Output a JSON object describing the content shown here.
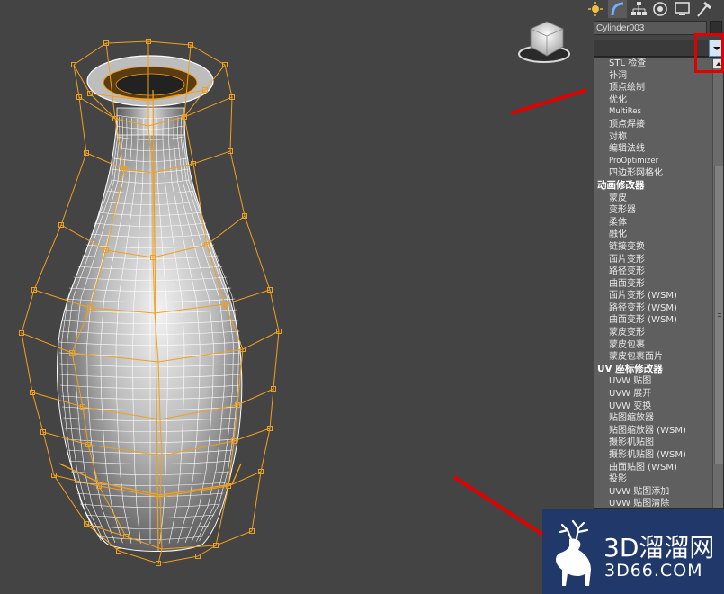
{
  "command_panel": {
    "tabs": [
      "create-tab",
      "modify-tab",
      "hierarchy-tab",
      "motion-tab",
      "display-tab",
      "utilities-tab"
    ],
    "object_name": "Cylinder003",
    "modifier_list_value": ""
  },
  "modifier_list": {
    "items": [
      {
        "type": "item",
        "label": "STL 检查",
        "small": false
      },
      {
        "type": "item",
        "label": "补洞",
        "small": false
      },
      {
        "type": "item",
        "label": "顶点绘制",
        "small": false
      },
      {
        "type": "item",
        "label": "优化",
        "small": false
      },
      {
        "type": "item",
        "label": "MultiRes",
        "small": true
      },
      {
        "type": "item",
        "label": "顶点焊接",
        "small": false
      },
      {
        "type": "item",
        "label": "对称",
        "small": false
      },
      {
        "type": "item",
        "label": "编辑法线",
        "small": false
      },
      {
        "type": "item",
        "label": "ProOptimizer",
        "small": true
      },
      {
        "type": "item",
        "label": "四边形网格化",
        "small": false
      },
      {
        "type": "cat",
        "label": "动画修改器"
      },
      {
        "type": "item",
        "label": "蒙皮",
        "small": false
      },
      {
        "type": "item",
        "label": "变形器",
        "small": false
      },
      {
        "type": "item",
        "label": "柔体",
        "small": false
      },
      {
        "type": "item",
        "label": "融化",
        "small": false
      },
      {
        "type": "item",
        "label": "链接变换",
        "small": false
      },
      {
        "type": "item",
        "label": "面片变形",
        "small": false
      },
      {
        "type": "item",
        "label": "路径变形",
        "small": false
      },
      {
        "type": "item",
        "label": "曲面变形",
        "small": false
      },
      {
        "type": "item",
        "label": "面片变形 (WSM)",
        "small": false
      },
      {
        "type": "item",
        "label": "路径变形 (WSM)",
        "small": false
      },
      {
        "type": "item",
        "label": "曲面变形 (WSM)",
        "small": false
      },
      {
        "type": "item",
        "label": "蒙皮变形",
        "small": false
      },
      {
        "type": "item",
        "label": "蒙皮包裹",
        "small": false
      },
      {
        "type": "item",
        "label": "蒙皮包裹面片",
        "small": false
      },
      {
        "type": "cat",
        "label": "UV 座标修改器"
      },
      {
        "type": "item",
        "label": "UVW 贴图",
        "small": false
      },
      {
        "type": "item",
        "label": "UVW 展开",
        "small": false
      },
      {
        "type": "item",
        "label": "UVW 变换",
        "small": false
      },
      {
        "type": "item",
        "label": "贴图缩放器",
        "small": false
      },
      {
        "type": "item",
        "label": "贴图缩放器 (WSM)",
        "small": false
      },
      {
        "type": "item",
        "label": "摄影机贴图",
        "small": false
      },
      {
        "type": "item",
        "label": "摄影机贴图 (WSM)",
        "small": false
      },
      {
        "type": "item",
        "label": "曲面贴图 (WSM)",
        "small": false
      },
      {
        "type": "item",
        "label": "投影",
        "small": false
      },
      {
        "type": "item",
        "label": "UVW 贴图添加",
        "small": false
      },
      {
        "type": "item",
        "label": "UVW 贴图清除",
        "small": false
      }
    ]
  },
  "watermark": {
    "logo_text": "3D溜溜网",
    "url": "3D66.COM"
  },
  "colors": {
    "viewport_bg": "#444444",
    "wire_white": "#ffffff",
    "cage_orange": "#f0a020",
    "annotation_red": "#e00000",
    "watermark_bg": "#1e376e"
  }
}
